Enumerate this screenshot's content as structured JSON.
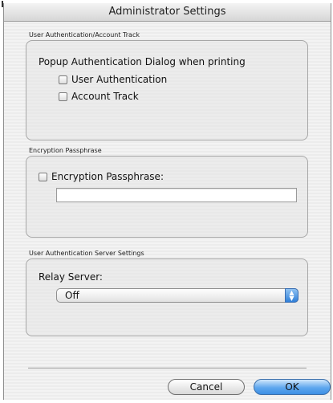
{
  "window": {
    "title": "Administrator Settings"
  },
  "user_auth_section": {
    "label": "User Authentication/Account Track",
    "heading": "Popup Authentication Dialog when printing",
    "options": [
      {
        "label": "User Authentication",
        "checked": false
      },
      {
        "label": "Account Track",
        "checked": false
      }
    ]
  },
  "encryption_section": {
    "label": "Encryption Passphrase",
    "checkbox_label": "Encryption Passphrase:",
    "checked": false,
    "field_value": ""
  },
  "server_section": {
    "label": "User Authentication Server Settings",
    "heading": "Relay Server:",
    "selected_value": "Off"
  },
  "buttons": {
    "cancel_label": "Cancel",
    "ok_label": "OK"
  },
  "colors": {
    "ok_button": "#4a95e6",
    "background": "#ececec"
  }
}
